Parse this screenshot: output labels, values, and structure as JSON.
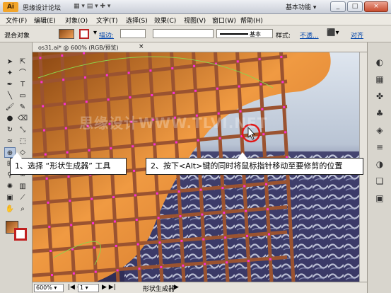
{
  "titlebar": {
    "site_text": "思缘设计论坛",
    "side_text": "Ai",
    "workspace_label": "基本功能",
    "minimize": "_",
    "maximize": "□",
    "close": "×"
  },
  "menu": [
    "文件(F)",
    "编辑(E)",
    "对象(O)",
    "文字(T)",
    "选择(S)",
    "效果(C)",
    "视图(V)",
    "窗口(W)",
    "帮助(H)"
  ],
  "controls": {
    "object_type": "混合对象",
    "stroke_label": "描边:",
    "brush_label": "基本",
    "style_label": "样式:",
    "opacity_link": "不透...",
    "align_link": "对齐"
  },
  "document": {
    "tab_label": "os31.ai* @ 600% (RGB/预览)",
    "watermark": "思缘设计WWW.TLVI.NET"
  },
  "callouts": {
    "step1": "1、选择 “形状生成器” 工具",
    "step2": "2、按下<Alt>键的同时将鼠标指针移动至要修剪的位置"
  },
  "status": {
    "zoom": "600%",
    "page": "1",
    "tool_name": "形状生成器"
  },
  "colors": {
    "accent": "#f2a52a",
    "grid_stroke": "#9b5330",
    "anchor": "#ff2fd6",
    "highlight_ring": "#e01818"
  },
  "tools_left": [
    "selection",
    "direct-selection",
    "magic-wand",
    "lasso",
    "pen",
    "type",
    "line",
    "rectangle",
    "paintbrush",
    "pencil",
    "blob-brush",
    "eraser",
    "rotate",
    "scale",
    "warp",
    "free-transform",
    "shape-builder",
    "perspective",
    "mesh",
    "gradient",
    "eyedropper",
    "blend",
    "symbol-sprayer",
    "column-graph",
    "artboard",
    "slice",
    "hand",
    "zoom"
  ],
  "tools_right": [
    "color",
    "swatches",
    "brushes",
    "symbols",
    "graphic-styles",
    "stroke",
    "transparency",
    "layers",
    "artboards"
  ]
}
